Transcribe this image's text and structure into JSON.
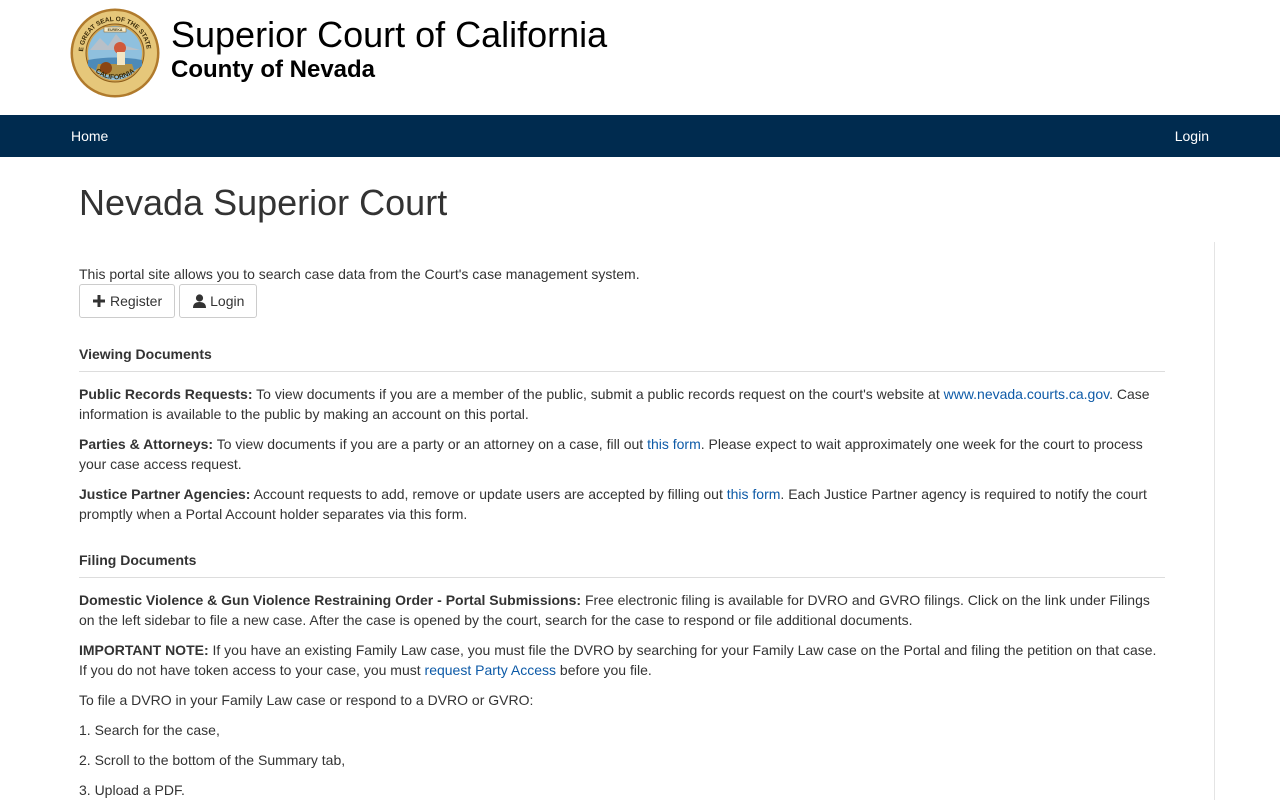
{
  "header": {
    "court_name": "Superior Court of California",
    "county_name": "County of Nevada",
    "seal": {
      "top_text": "THE GREAT SEAL OF THE STATE OF",
      "bottom_text": "CALIFORNIA",
      "banner_text": "EUREKA"
    }
  },
  "nav": {
    "home_label": "Home",
    "login_label": "Login"
  },
  "page": {
    "title": "Nevada Superior Court",
    "intro": "This portal site allows you to search case data from the Court's case management system.",
    "register_button": "Register",
    "login_button": "Login"
  },
  "viewing": {
    "heading": "Viewing Documents",
    "public_records_label": "Public Records Requests:",
    "public_records_text1": " To view documents if you are a member of the public, submit a public records request on the court's website at ",
    "public_records_link": "www.nevada.courts.ca.gov",
    "public_records_text2": ". Case information is available to the public by making an account on this portal.",
    "parties_label": "Parties & Attorneys:",
    "parties_text1": " To view documents if you are a party or an attorney on a case, fill out ",
    "parties_link": "this form",
    "parties_text2": ". Please expect to wait approximately one week for the court to process your case access request.",
    "justice_label": "Justice Partner Agencies:",
    "justice_text1": " Account requests to add, remove or update users are accepted by filling out ",
    "justice_link": "this form",
    "justice_text2": ". Each Justice Partner agency is required to notify the court promptly when a Portal Account holder separates via this form."
  },
  "filing": {
    "heading": "Filing Documents",
    "dv_label": "Domestic Violence & Gun Violence Restraining Order - Portal Submissions:",
    "dv_text": " Free electronic filing is available for DVRO and GVRO filings. Click on the link under Filings on the left sidebar to file a new case. After the case is opened by the court, search for the case to respond or file additional documents.",
    "note_label": "IMPORTANT NOTE:",
    "note_text1": " If you have an existing Family Law case, you must file the DVRO by searching for your Family Law case on the Portal and filing the petition on that case. If you do not have token access to your case, you must ",
    "note_link": "request Party Access",
    "note_text2": " before you file.",
    "steps_intro": "To file a DVRO in your Family Law case or respond to a DVRO or GVRO:",
    "steps": [
      "1. Search for the case,",
      "2. Scroll to the bottom of the Summary tab,",
      "3. Upload a PDF."
    ]
  },
  "colors": {
    "navbar": "#002b4f",
    "link": "#0d5aa7",
    "text": "#333333"
  }
}
